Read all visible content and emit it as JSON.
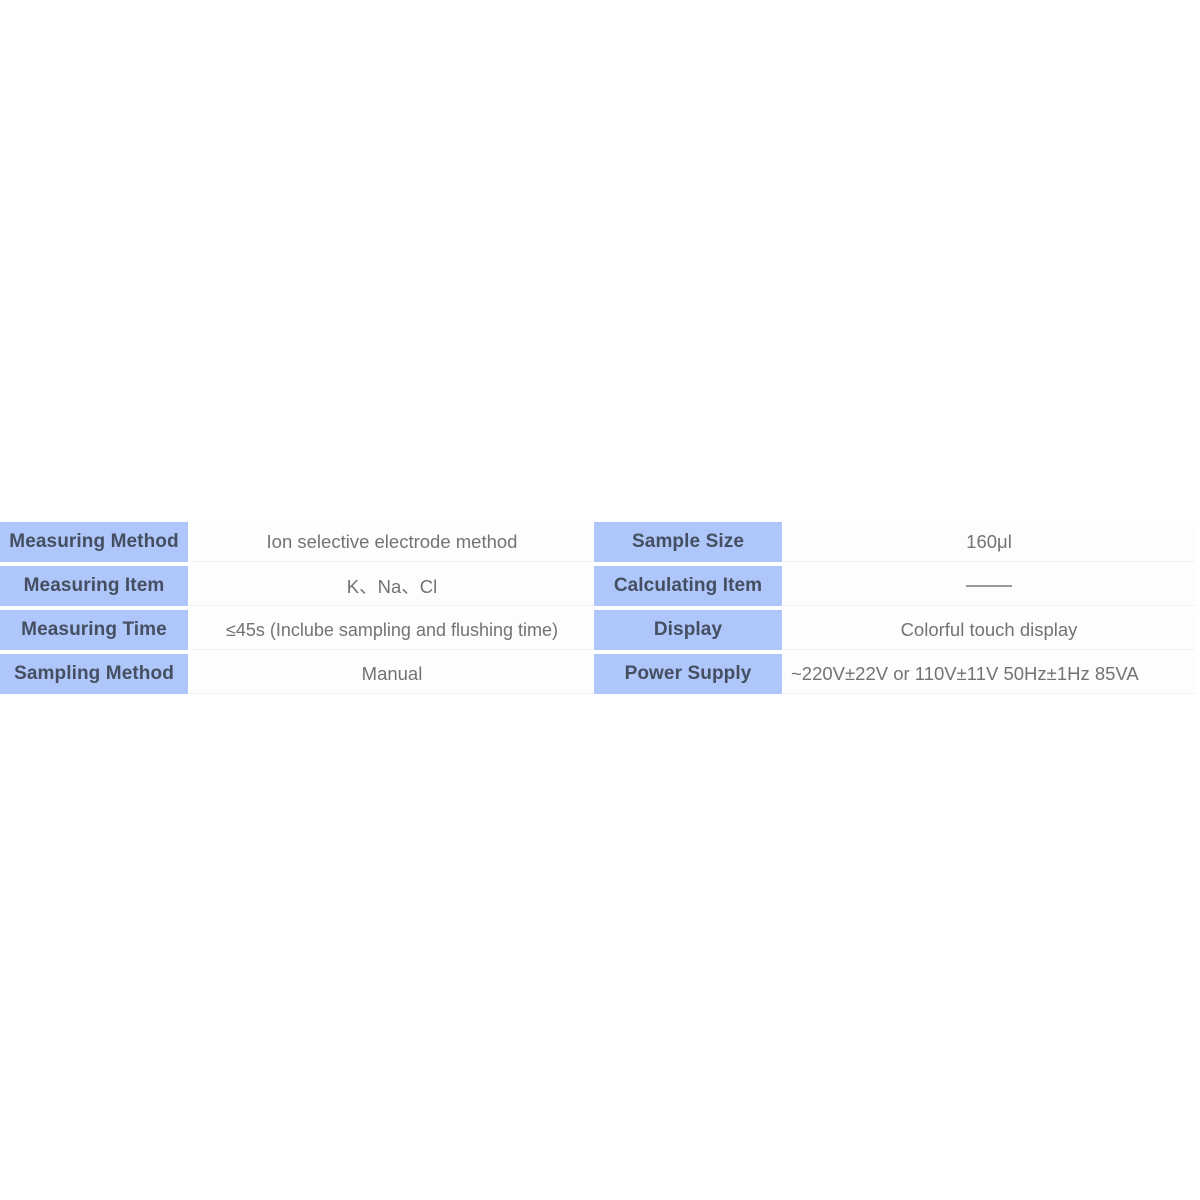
{
  "table": {
    "rows": [
      {
        "label_left": "Measuring Method",
        "value_left": "Ion selective electrode method",
        "label_right": "Sample Size",
        "value_right": "160μl"
      },
      {
        "label_left": "Measuring Item",
        "value_left": "K、Na、Cl",
        "label_right": "Calculating Item",
        "value_right": "——"
      },
      {
        "label_left": "Measuring Time",
        "value_left": "≤45s (Inclube sampling and flushing time)",
        "label_right": "Display",
        "value_right": "Colorful touch display"
      },
      {
        "label_left": "Sampling Method",
        "value_left": "Manual",
        "label_right": "Power Supply",
        "value_right": "~220V±22V or 110V±11V 50Hz±1Hz  85VA"
      }
    ]
  },
  "colors": {
    "label_background": "#aec6fa",
    "label_text": "#454f61",
    "value_background": "#fdfdfd",
    "value_text": "#737373",
    "page_background": "#ffffff"
  }
}
